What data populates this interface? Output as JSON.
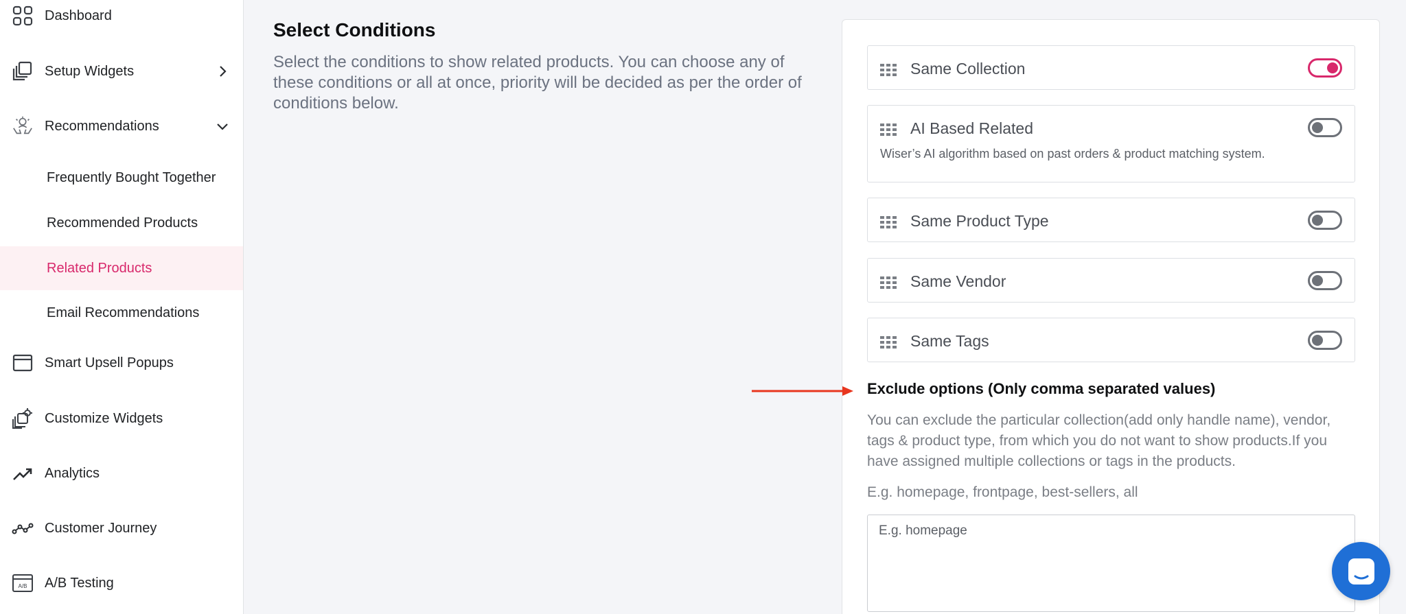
{
  "sidebar": {
    "items": [
      {
        "label": "Dashboard",
        "icon": "dashboard-grid-icon"
      },
      {
        "label": "Setup Widgets",
        "icon": "widgets-icon"
      },
      {
        "label": "Recommendations",
        "icon": "recommendations-icon"
      },
      {
        "label": "Smart Upsell Popups",
        "icon": "window-icon"
      },
      {
        "label": "Customize Widgets",
        "icon": "customize-icon"
      },
      {
        "label": "Analytics",
        "icon": "trend-up-icon"
      },
      {
        "label": "Customer Journey",
        "icon": "journey-icon"
      },
      {
        "label": "A/B Testing",
        "icon": "ab-testing-icon"
      }
    ],
    "sub_items": [
      {
        "label": "Frequently Bought Together"
      },
      {
        "label": "Recommended Products"
      },
      {
        "label": "Related Products"
      },
      {
        "label": "Email Recommendations"
      }
    ],
    "ab_icon_text": "A/B"
  },
  "main": {
    "title": "Select Conditions",
    "description": "Select the conditions to show related products. You can choose any of these conditions or all at once, priority will be decided as per the order of conditions below."
  },
  "conditions": [
    {
      "name": "Same Collection",
      "enabled": true
    },
    {
      "name": "AI Based Related",
      "enabled": false,
      "subtext": "Wiser’s AI algorithm based on past orders & product matching system."
    },
    {
      "name": "Same Product Type",
      "enabled": false
    },
    {
      "name": "Same Vendor",
      "enabled": false
    },
    {
      "name": "Same Tags",
      "enabled": false
    }
  ],
  "exclude": {
    "title": "Exclude options (Only comma separated values)",
    "description": "You can exclude the particular collection(add only handle name), vendor, tags & product type, from which you do not want to show products.If you have assigned multiple collections or tags in the products.",
    "example": "E.g. homepage, frontpage, best-sellers, all",
    "placeholder": "E.g. homepage",
    "value": ""
  },
  "colors": {
    "accent": "#d8286b",
    "arrow": "#e8361f",
    "chat": "#1f6fd6"
  },
  "chat_icon": "chat-icon"
}
